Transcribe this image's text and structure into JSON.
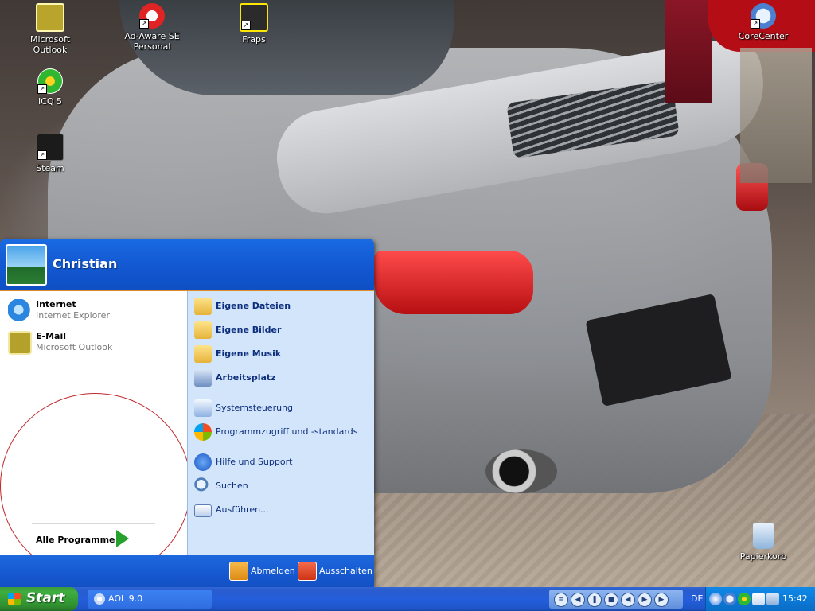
{
  "desktop": {
    "icons": [
      {
        "label": "Microsoft Outlook"
      },
      {
        "label": "Ad-Aware SE Personal"
      },
      {
        "label": "Fraps"
      },
      {
        "label": "CoreCenter"
      },
      {
        "label": "ICQ 5"
      },
      {
        "label": "Steam"
      },
      {
        "label": "Papierkorb"
      }
    ],
    "shortcut_arrow": "↗"
  },
  "start_menu": {
    "user_name": "Christian",
    "pinned": [
      {
        "title": "Internet",
        "subtitle": "Internet Explorer"
      },
      {
        "title": "E-Mail",
        "subtitle": "Microsoft Outlook"
      }
    ],
    "all_programs": "Alle Programme",
    "right": [
      {
        "label": "Eigene Dateien"
      },
      {
        "label": "Eigene Bilder"
      },
      {
        "label": "Eigene Musik"
      },
      {
        "label": "Arbeitsplatz"
      },
      {
        "label": "Systemsteuerung"
      },
      {
        "label": "Programmzugriff und -standards"
      },
      {
        "label": "Hilfe und Support"
      },
      {
        "label": "Suchen"
      },
      {
        "label": "Ausführen..."
      }
    ],
    "logoff": "Abmelden",
    "shutdown": "Ausschalten"
  },
  "taskbar": {
    "start_label": "Start",
    "tasks": [
      {
        "label": "AOL 9.0"
      }
    ],
    "language": "DE",
    "clock": "15:42"
  },
  "colors": {
    "start_green": "#3fae3f",
    "xp_blue": "#245edb",
    "accent_orange": "#e08a2a",
    "annotation_circle": "#c1272d"
  }
}
